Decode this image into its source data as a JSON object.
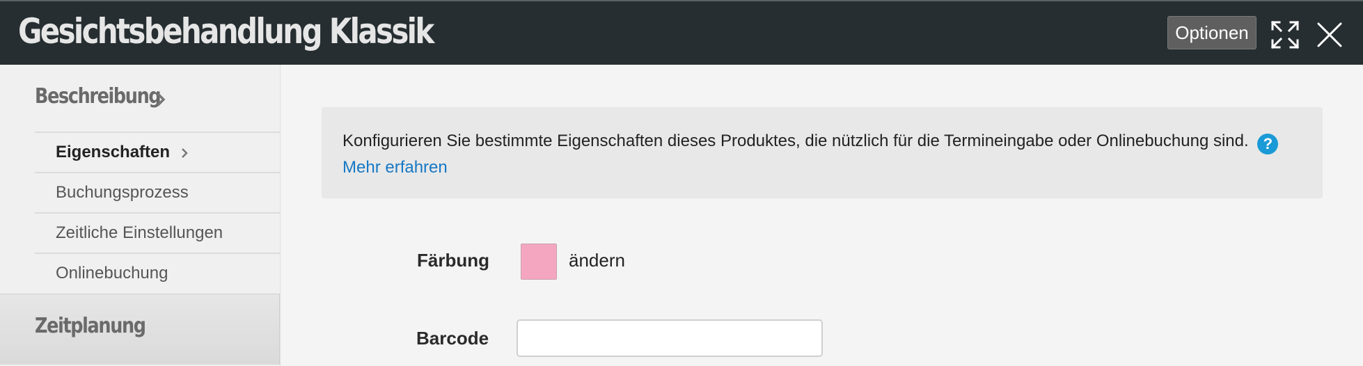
{
  "window": {
    "title": "Gesichtsbehandlung Klassik",
    "options_label": "Optionen",
    "expand_icon": "expand-icon",
    "close_icon": "close-icon"
  },
  "sidebar": {
    "section_title": "Beschreibung",
    "items": [
      {
        "label": "Eigenschaften",
        "active": true
      },
      {
        "label": "Buchungsprozess",
        "active": false
      },
      {
        "label": "Zeitliche Einstellungen",
        "active": false
      },
      {
        "label": "Onlinebuchung",
        "active": false
      }
    ],
    "next_section": "Zeitplanung"
  },
  "info": {
    "text": "Konfigurieren Sie bestimmte Eigenschaften dieses Produktes, die nützlich für die Termineingabe oder Onlinebuchung sind.",
    "help_icon": "?",
    "link": "Mehr erfahren"
  },
  "form": {
    "color_label": "Färbung",
    "color_value": "#f4a6c0",
    "color_change": "ändern",
    "barcode_label": "Barcode",
    "barcode_value": ""
  }
}
